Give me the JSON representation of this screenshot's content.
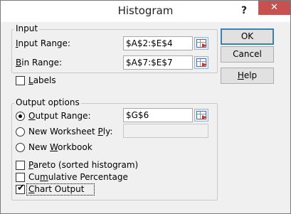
{
  "window": {
    "title": "Histogram",
    "help_glyph": "?",
    "close_glyph": "✕"
  },
  "input_group": {
    "legend": "Input",
    "input_range_label": "Input Range:",
    "input_range_value": "$A$2:$E$4",
    "bin_range_label": "Bin Range:",
    "bin_range_value": "$A$7:$E$7",
    "labels_label": "Labels",
    "labels_checked": false
  },
  "output_group": {
    "legend": "Output options",
    "output_range_label": "Output Range:",
    "output_range_value": "$G$6",
    "new_worksheet_label": "New Worksheet Ply:",
    "new_worksheet_value": "",
    "new_workbook_label": "New Workbook",
    "selected_option": "Output Range",
    "pareto_label": "Pareto (sorted histogram)",
    "pareto_checked": false,
    "cumulative_label": "Cumulative Percentage",
    "cumulative_checked": false,
    "chart_output_label": "Chart Output",
    "chart_output_checked": true
  },
  "buttons": {
    "ok": "OK",
    "cancel": "Cancel",
    "help": "Help"
  },
  "icons": {
    "refedit": "range-select-icon",
    "check": "✔"
  }
}
